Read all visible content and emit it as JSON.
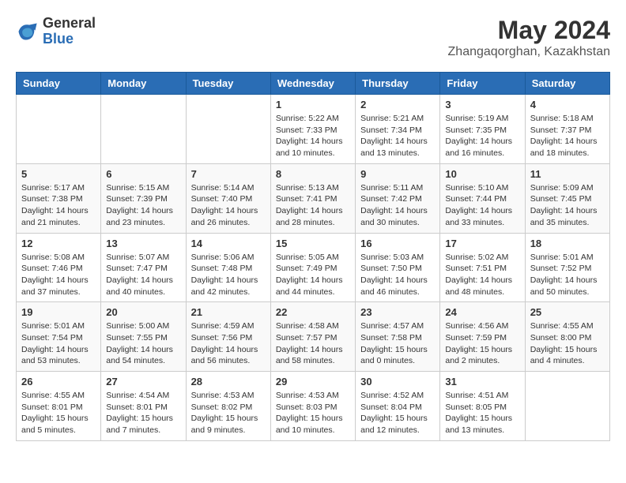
{
  "header": {
    "logo_general": "General",
    "logo_blue": "Blue",
    "month_year": "May 2024",
    "location": "Zhangaqorghan, Kazakhstan"
  },
  "weekdays": [
    "Sunday",
    "Monday",
    "Tuesday",
    "Wednesday",
    "Thursday",
    "Friday",
    "Saturday"
  ],
  "weeks": [
    [
      {
        "day": "",
        "info": ""
      },
      {
        "day": "",
        "info": ""
      },
      {
        "day": "",
        "info": ""
      },
      {
        "day": "1",
        "info": "Sunrise: 5:22 AM\nSunset: 7:33 PM\nDaylight: 14 hours\nand 10 minutes."
      },
      {
        "day": "2",
        "info": "Sunrise: 5:21 AM\nSunset: 7:34 PM\nDaylight: 14 hours\nand 13 minutes."
      },
      {
        "day": "3",
        "info": "Sunrise: 5:19 AM\nSunset: 7:35 PM\nDaylight: 14 hours\nand 16 minutes."
      },
      {
        "day": "4",
        "info": "Sunrise: 5:18 AM\nSunset: 7:37 PM\nDaylight: 14 hours\nand 18 minutes."
      }
    ],
    [
      {
        "day": "5",
        "info": "Sunrise: 5:17 AM\nSunset: 7:38 PM\nDaylight: 14 hours\nand 21 minutes."
      },
      {
        "day": "6",
        "info": "Sunrise: 5:15 AM\nSunset: 7:39 PM\nDaylight: 14 hours\nand 23 minutes."
      },
      {
        "day": "7",
        "info": "Sunrise: 5:14 AM\nSunset: 7:40 PM\nDaylight: 14 hours\nand 26 minutes."
      },
      {
        "day": "8",
        "info": "Sunrise: 5:13 AM\nSunset: 7:41 PM\nDaylight: 14 hours\nand 28 minutes."
      },
      {
        "day": "9",
        "info": "Sunrise: 5:11 AM\nSunset: 7:42 PM\nDaylight: 14 hours\nand 30 minutes."
      },
      {
        "day": "10",
        "info": "Sunrise: 5:10 AM\nSunset: 7:44 PM\nDaylight: 14 hours\nand 33 minutes."
      },
      {
        "day": "11",
        "info": "Sunrise: 5:09 AM\nSunset: 7:45 PM\nDaylight: 14 hours\nand 35 minutes."
      }
    ],
    [
      {
        "day": "12",
        "info": "Sunrise: 5:08 AM\nSunset: 7:46 PM\nDaylight: 14 hours\nand 37 minutes."
      },
      {
        "day": "13",
        "info": "Sunrise: 5:07 AM\nSunset: 7:47 PM\nDaylight: 14 hours\nand 40 minutes."
      },
      {
        "day": "14",
        "info": "Sunrise: 5:06 AM\nSunset: 7:48 PM\nDaylight: 14 hours\nand 42 minutes."
      },
      {
        "day": "15",
        "info": "Sunrise: 5:05 AM\nSunset: 7:49 PM\nDaylight: 14 hours\nand 44 minutes."
      },
      {
        "day": "16",
        "info": "Sunrise: 5:03 AM\nSunset: 7:50 PM\nDaylight: 14 hours\nand 46 minutes."
      },
      {
        "day": "17",
        "info": "Sunrise: 5:02 AM\nSunset: 7:51 PM\nDaylight: 14 hours\nand 48 minutes."
      },
      {
        "day": "18",
        "info": "Sunrise: 5:01 AM\nSunset: 7:52 PM\nDaylight: 14 hours\nand 50 minutes."
      }
    ],
    [
      {
        "day": "19",
        "info": "Sunrise: 5:01 AM\nSunset: 7:54 PM\nDaylight: 14 hours\nand 53 minutes."
      },
      {
        "day": "20",
        "info": "Sunrise: 5:00 AM\nSunset: 7:55 PM\nDaylight: 14 hours\nand 54 minutes."
      },
      {
        "day": "21",
        "info": "Sunrise: 4:59 AM\nSunset: 7:56 PM\nDaylight: 14 hours\nand 56 minutes."
      },
      {
        "day": "22",
        "info": "Sunrise: 4:58 AM\nSunset: 7:57 PM\nDaylight: 14 hours\nand 58 minutes."
      },
      {
        "day": "23",
        "info": "Sunrise: 4:57 AM\nSunset: 7:58 PM\nDaylight: 15 hours\nand 0 minutes."
      },
      {
        "day": "24",
        "info": "Sunrise: 4:56 AM\nSunset: 7:59 PM\nDaylight: 15 hours\nand 2 minutes."
      },
      {
        "day": "25",
        "info": "Sunrise: 4:55 AM\nSunset: 8:00 PM\nDaylight: 15 hours\nand 4 minutes."
      }
    ],
    [
      {
        "day": "26",
        "info": "Sunrise: 4:55 AM\nSunset: 8:01 PM\nDaylight: 15 hours\nand 5 minutes."
      },
      {
        "day": "27",
        "info": "Sunrise: 4:54 AM\nSunset: 8:01 PM\nDaylight: 15 hours\nand 7 minutes."
      },
      {
        "day": "28",
        "info": "Sunrise: 4:53 AM\nSunset: 8:02 PM\nDaylight: 15 hours\nand 9 minutes."
      },
      {
        "day": "29",
        "info": "Sunrise: 4:53 AM\nSunset: 8:03 PM\nDaylight: 15 hours\nand 10 minutes."
      },
      {
        "day": "30",
        "info": "Sunrise: 4:52 AM\nSunset: 8:04 PM\nDaylight: 15 hours\nand 12 minutes."
      },
      {
        "day": "31",
        "info": "Sunrise: 4:51 AM\nSunset: 8:05 PM\nDaylight: 15 hours\nand 13 minutes."
      },
      {
        "day": "",
        "info": ""
      }
    ]
  ]
}
